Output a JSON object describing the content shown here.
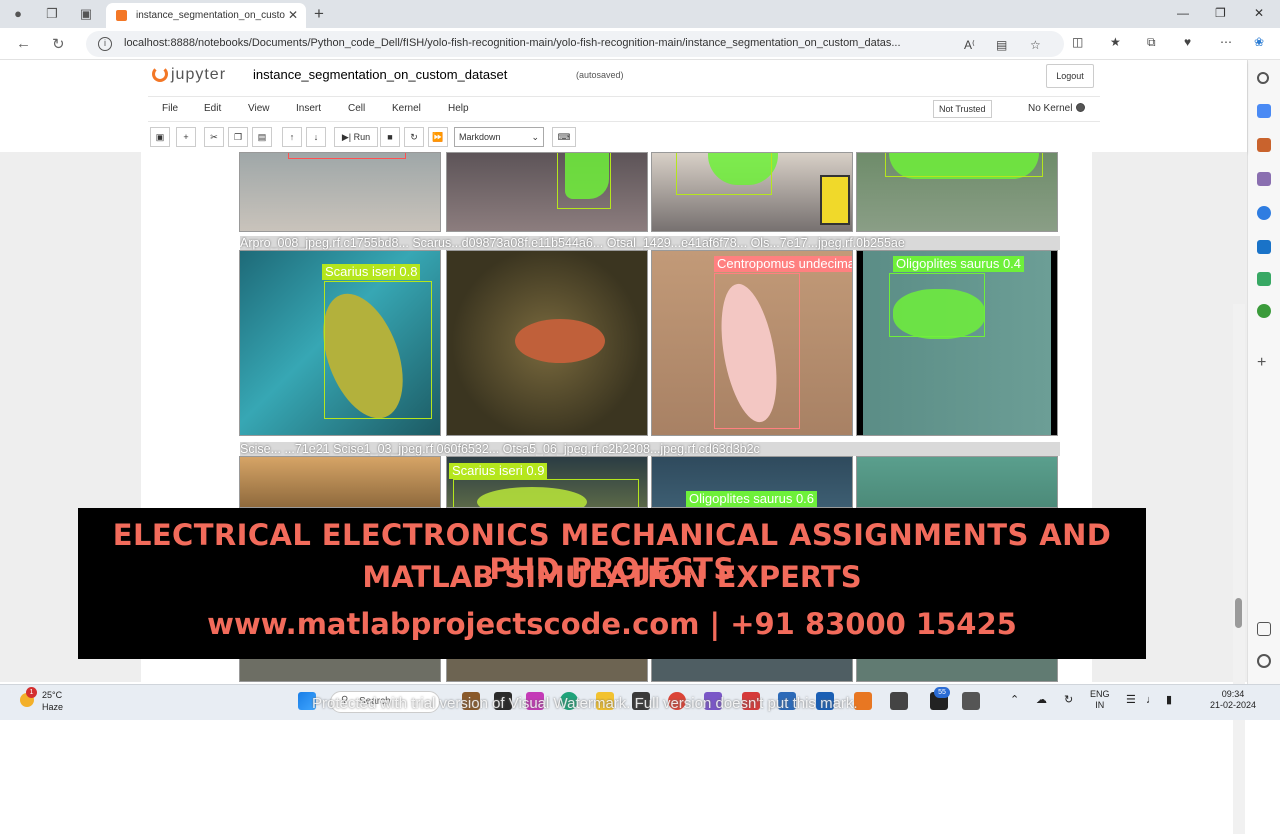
{
  "browser": {
    "tab_title": "instance_segmentation_on_custo",
    "url": "localhost:8888/notebooks/Documents/Python_code_Dell/fISH/yolo-fish-recognition-main/yolo-fish-recognition-main/instance_segmentation_on_custom_datas..."
  },
  "jupyter": {
    "logo_text": "jupyter",
    "notebook_title": "instance_segmentation_on_custom_dataset",
    "autosave": "(autosaved)",
    "logout": "Logout",
    "menu": [
      "File",
      "Edit",
      "View",
      "Insert",
      "Cell",
      "Kernel",
      "Help"
    ],
    "trust": "Not Trusted",
    "kernel": "No Kernel",
    "run_label": "Run",
    "cell_type": "Markdown"
  },
  "output": {
    "row1_filenames": "Arpro_008_jpeg.rf.c1755bd8...  Scarus...d09873a08f.e11b544a6... Otsal_1429...e41af6f78... Ols...7e17...jpeg.rf.0b255ae",
    "row2_filenames": "Scise...   ...71e21 Scise1_03_jpeg.rf.060f6532... Otsa5_06_jpeg.rf.c2b2308...jpeg.rf.cd63d3b2c",
    "labels": {
      "l1": "Scarius iseri 0.8",
      "l2": "Centropomus undecimalis",
      "l3": "Oligoplites saurus 0.4",
      "l4": "Scarius iseri 0.9",
      "l5": "Oligoplites saurus 0.6"
    }
  },
  "banner": {
    "line1": "ELECTRICAL ELECTRONICS MECHANICAL ASSIGNMENTS AND PHD PROJECTS",
    "line2": "MATLAB SIMULATION EXPERTS",
    "line3": "www.matlabprojectscode.com | +91 83000 15425"
  },
  "taskbar": {
    "temp": "25°C",
    "weather": "Haze",
    "weather_badge": "1",
    "search": "Search",
    "watermark": "Protected with trial version of Visual Watermark. Full version doesn't put this mark.",
    "notif_badge": "55",
    "lang1": "ENG",
    "lang2": "IN",
    "time": "09:34",
    "date": "21-02-2024"
  },
  "colors": {
    "jupyter_orange": "#f37726",
    "banner_text": "#f26b5b",
    "mask_green": "#6ef03a"
  }
}
